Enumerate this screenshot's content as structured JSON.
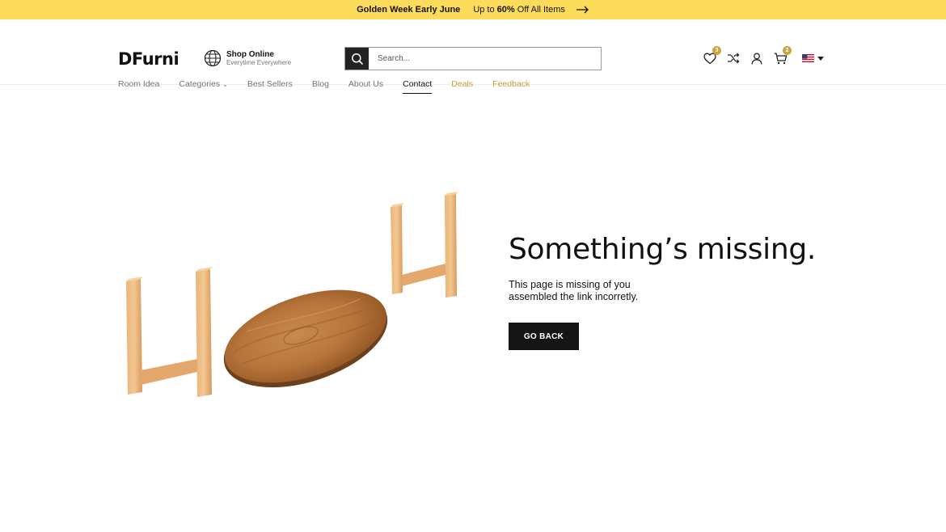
{
  "promo": {
    "headline": "Golden Week Early June",
    "offer_prefix": "Up to ",
    "offer_percent": "60%",
    "offer_suffix": " Off All Items"
  },
  "header": {
    "logo": "DFurni",
    "shop": {
      "title": "Shop Online",
      "subtitle": "Everytime Everywhere"
    },
    "search": {
      "placeholder": "Search..."
    },
    "wishlist_count": "3",
    "cart_count": "2",
    "icons": [
      "heart-icon",
      "shuffle-icon",
      "user-icon",
      "cart-icon",
      "us-flag-icon"
    ]
  },
  "nav": {
    "items": [
      "Room Idea",
      "Categories",
      "Best Sellers",
      "Blog",
      "About Us",
      "Contact",
      "Deals",
      "Feedback"
    ],
    "active": "Contact"
  },
  "error": {
    "title": "Something’s missing.",
    "message": "This page is missing of you assembled the link incorretly.",
    "button": "GO BACK"
  },
  "colors": {
    "promo_bg": "#fddc5c",
    "accent_gold": "#c2a23a",
    "button_bg": "#151515"
  }
}
